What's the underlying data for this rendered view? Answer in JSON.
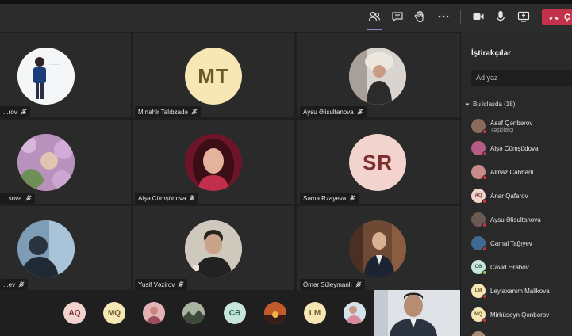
{
  "toolbar": {
    "leave_label": "Ç",
    "icons": [
      "participants-icon",
      "chat-icon",
      "raise-hand-icon",
      "more-icon",
      "camera-icon",
      "mic-icon",
      "share-icon",
      "phone-icon"
    ]
  },
  "tiles": [
    {
      "name": "...rov"
    },
    {
      "name": "Mirtahir Talıbzadə",
      "initials": "MT"
    },
    {
      "name": "Aysu Əlisultanova"
    },
    {
      "name": "...sova"
    },
    {
      "name": "Aişə Cümşüdova"
    },
    {
      "name": "Səma Rzayeva",
      "initials": "SR"
    },
    {
      "name": "...ev"
    },
    {
      "name": "Yusif Vəzirov"
    },
    {
      "name": "Ömər Süleymanlı"
    }
  ],
  "bottom_avatars": [
    {
      "initials": "AQ"
    },
    {
      "initials": "MQ"
    },
    {
      "initials": ""
    },
    {
      "initials": ""
    },
    {
      "initials": "CƏ"
    },
    {
      "initials": ""
    },
    {
      "initials": "LM"
    },
    {
      "initials": ""
    }
  ],
  "panel": {
    "title": "İştirakçılar",
    "search_placeholder": "Ad yaz",
    "section": "Bu iclasda (18)",
    "participants": [
      {
        "name": "Asəf Qənbərov",
        "role": "Təşkilatçı",
        "initials": "",
        "status": "#c4314b"
      },
      {
        "name": "Aişə Cümşüdova",
        "initials": "",
        "status": "#c4314b"
      },
      {
        "name": "Almaz Cabbarlı",
        "initials": "",
        "status": "#c4314b"
      },
      {
        "name": "Anar Qafarov",
        "initials": "AQ",
        "status": "#c4314b"
      },
      {
        "name": "Aysu Əlisultanova",
        "initials": "",
        "status": "#c4314b"
      },
      {
        "name": "Camal Tağıyev",
        "initials": "",
        "status": "#c4314b"
      },
      {
        "name": "Cavid Ərəbov",
        "initials": "CƏ",
        "status": "#92c353"
      },
      {
        "name": "Leylaxanım Malikova",
        "initials": "LM",
        "status": "#c4314b"
      },
      {
        "name": "Mirhüseyn Qənbərov",
        "initials": "MQ",
        "status": "#c4314b"
      },
      {
        "name": "",
        "initials": "",
        "status": "#c4314b"
      }
    ]
  },
  "colors": {
    "avatar_cream": "#f6e7b5",
    "avatar_mint": "#c5e6d9",
    "leave_red": "#c4314b",
    "accent": "#8b8cc7"
  }
}
